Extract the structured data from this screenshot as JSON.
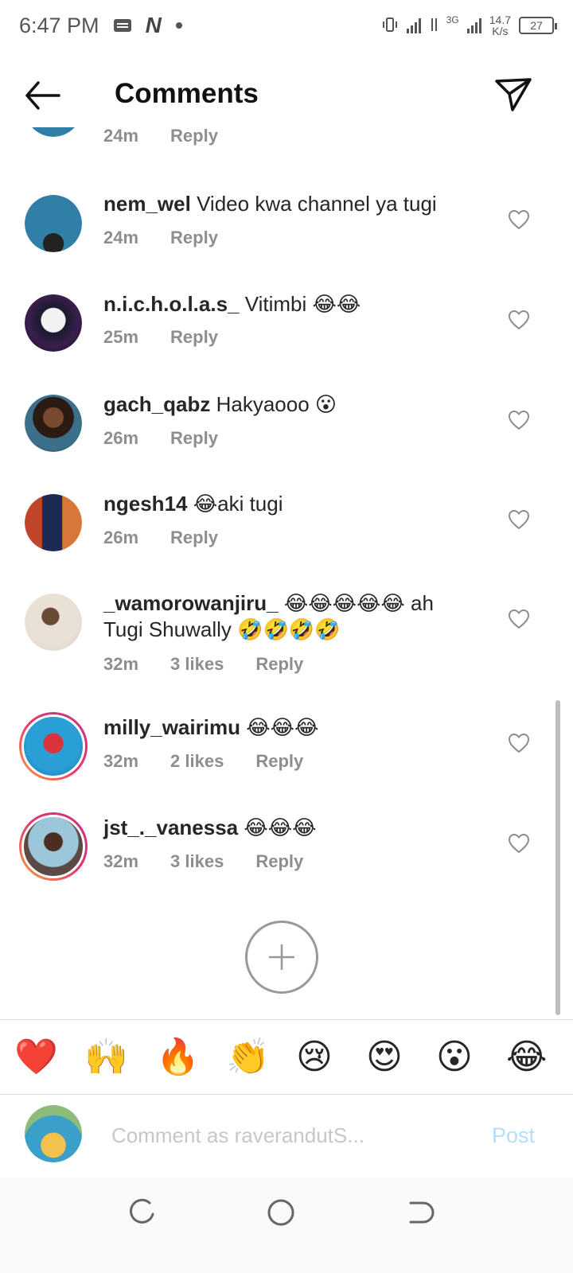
{
  "status_bar": {
    "time": "6:47 PM",
    "network_type": "3G",
    "speed_value": "14.7",
    "speed_unit": "K/s",
    "battery": "27"
  },
  "header": {
    "title": "Comments"
  },
  "comments": [
    {
      "username": "",
      "text": "",
      "time": "24m",
      "likes": "",
      "reply": "Reply"
    },
    {
      "username": "nem_wel",
      "text": "Video kwa channel ya tugi",
      "time": "24m",
      "likes": "",
      "reply": "Reply"
    },
    {
      "username": "n.i.c.h.o.l.a.s_",
      "text": "Vitimbi 😂😂",
      "time": "25m",
      "likes": "",
      "reply": "Reply"
    },
    {
      "username": "gach_qabz",
      "text": "Hakyaooo 😮",
      "time": "26m",
      "likes": "",
      "reply": "Reply"
    },
    {
      "username": "ngesh14",
      "text": "😂aki tugi",
      "time": "26m",
      "likes": "",
      "reply": "Reply"
    },
    {
      "username": "_wamorowanjiru_",
      "text": "😂😂😂😂😂 ah Tugi Shuwally 🤣🤣🤣🤣",
      "time": "32m",
      "likes": "3 likes",
      "reply": "Reply"
    },
    {
      "username": "milly_wairimu",
      "text": "😂😂😂",
      "time": "32m",
      "likes": "2 likes",
      "reply": "Reply"
    },
    {
      "username": "jst_._vanessa",
      "text": "😂😂😂",
      "time": "32m",
      "likes": "3 likes",
      "reply": "Reply"
    }
  ],
  "quick_reactions": [
    "❤️",
    "🙌",
    "🔥",
    "👏",
    "😢",
    "😍",
    "😮",
    "😂"
  ],
  "composer": {
    "placeholder": "Comment as raverandutS...",
    "post_label": "Post"
  },
  "colors": {
    "text": "#262626",
    "meta": "#8e8e8e",
    "post_disabled": "#b2dffc",
    "story_ring_start": "#f9a23b",
    "story_ring_end": "#c13584"
  }
}
